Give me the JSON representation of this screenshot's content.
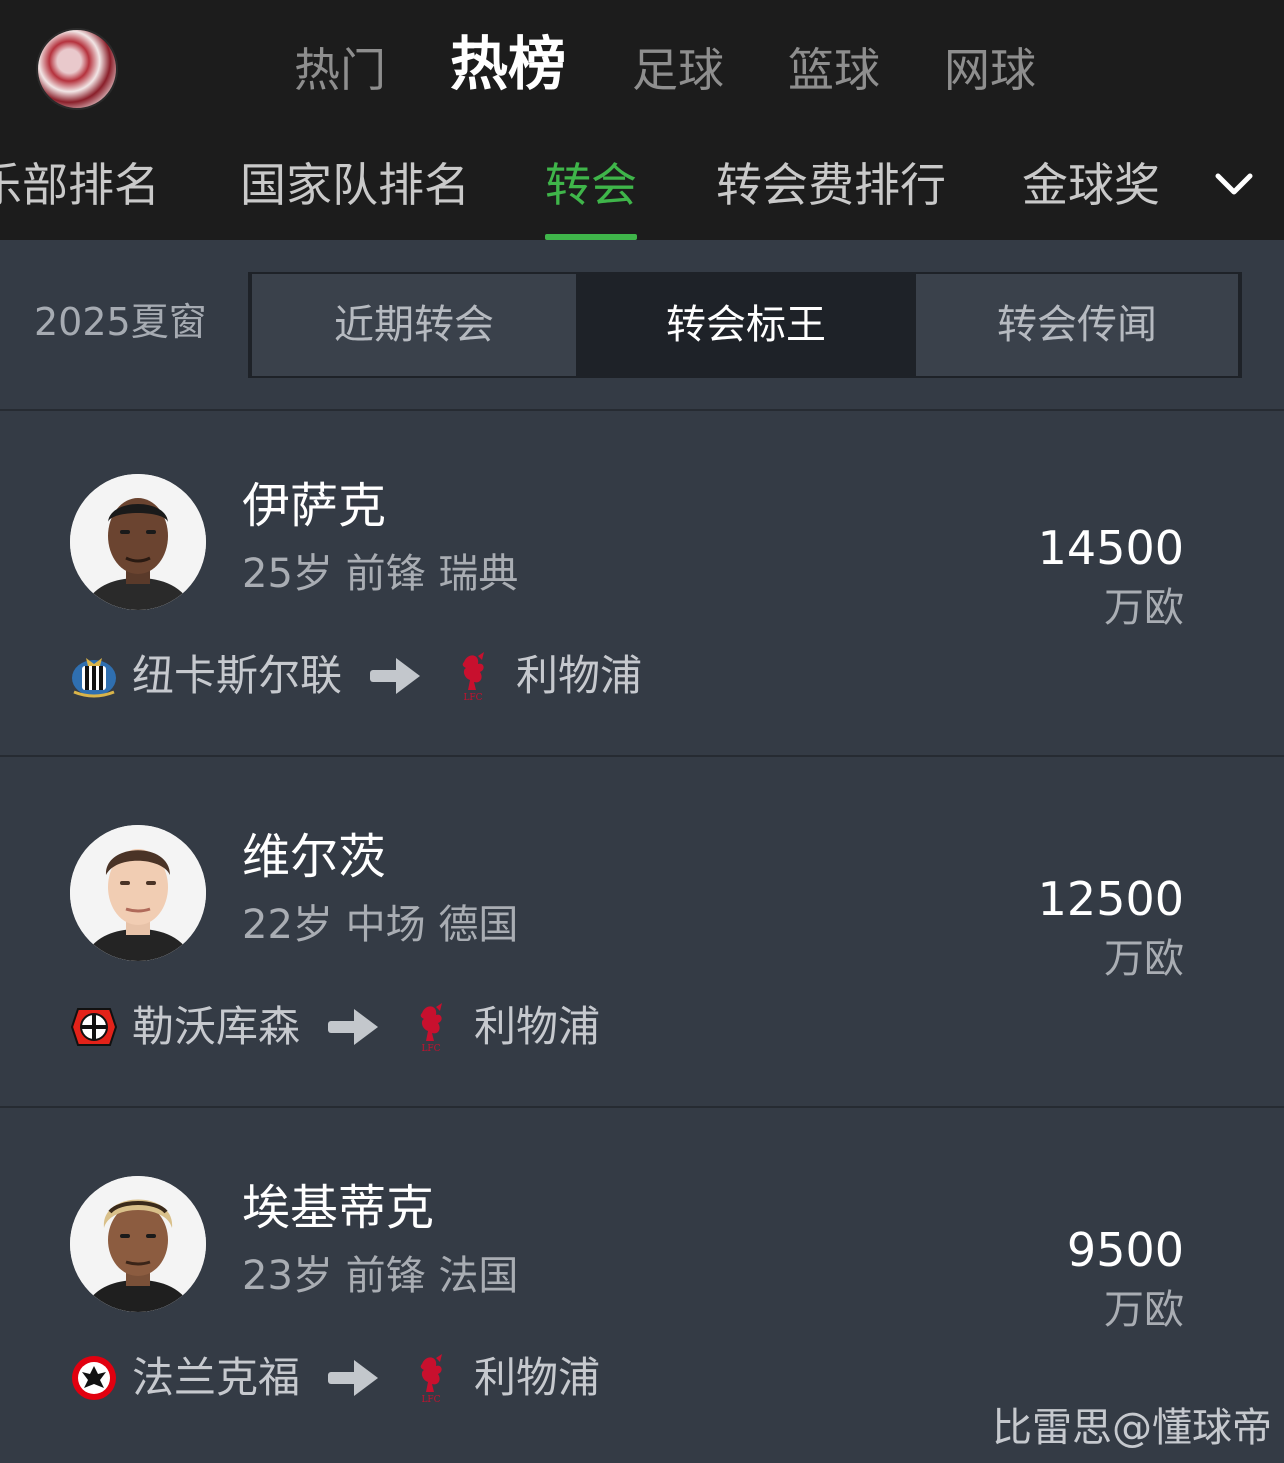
{
  "header": {
    "top_tabs": [
      "热门",
      "热榜",
      "足球",
      "篮球",
      "网球"
    ],
    "active_top_tab": "热榜",
    "sub_tabs": [
      "乐部排名",
      "国家队排名",
      "转会",
      "转会费排行",
      "金球奖"
    ],
    "active_sub_tab": "转会"
  },
  "filter": {
    "window_label": "2025夏窗",
    "segments": [
      "近期转会",
      "转会标王",
      "转会传闻"
    ],
    "active_segment": "转会标王"
  },
  "players": [
    {
      "name": "伊萨克",
      "meta": "25岁 前锋 瑞典",
      "fee": "14500",
      "unit": "万欧",
      "from_club": "纽卡斯尔联",
      "to_club": "利物浦"
    },
    {
      "name": "维尔茨",
      "meta": "22岁 中场 德国",
      "fee": "12500",
      "unit": "万欧",
      "from_club": "勒沃库森",
      "to_club": "利物浦"
    },
    {
      "name": "埃基蒂克",
      "meta": "23岁 前锋 法国",
      "fee": "9500",
      "unit": "万欧",
      "from_club": "法兰克福",
      "to_club": "利物浦"
    }
  ],
  "watermark": "比雷思@懂球帝",
  "colors": {
    "accent": "#3fb54a",
    "header_bg": "#1c1c1c",
    "list_bg": "#343b45",
    "lfc_red": "#c8102e"
  }
}
